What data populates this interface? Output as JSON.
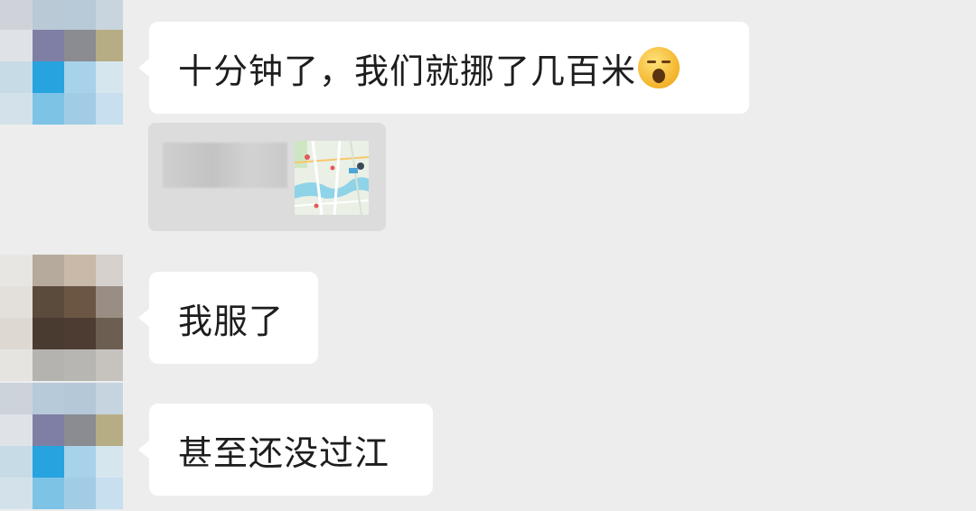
{
  "messages": [
    {
      "type": "text",
      "text": "十分钟了，我们就挪了几百米",
      "emoji": "yawning-face"
    },
    {
      "type": "share-card",
      "thumbnail": "map"
    },
    {
      "type": "text",
      "text": "我服了"
    },
    {
      "type": "text",
      "text": "甚至还没过江"
    }
  ],
  "colors": {
    "background": "#ededed",
    "bubble": "#ffffff",
    "text": "#1d1d1d"
  }
}
